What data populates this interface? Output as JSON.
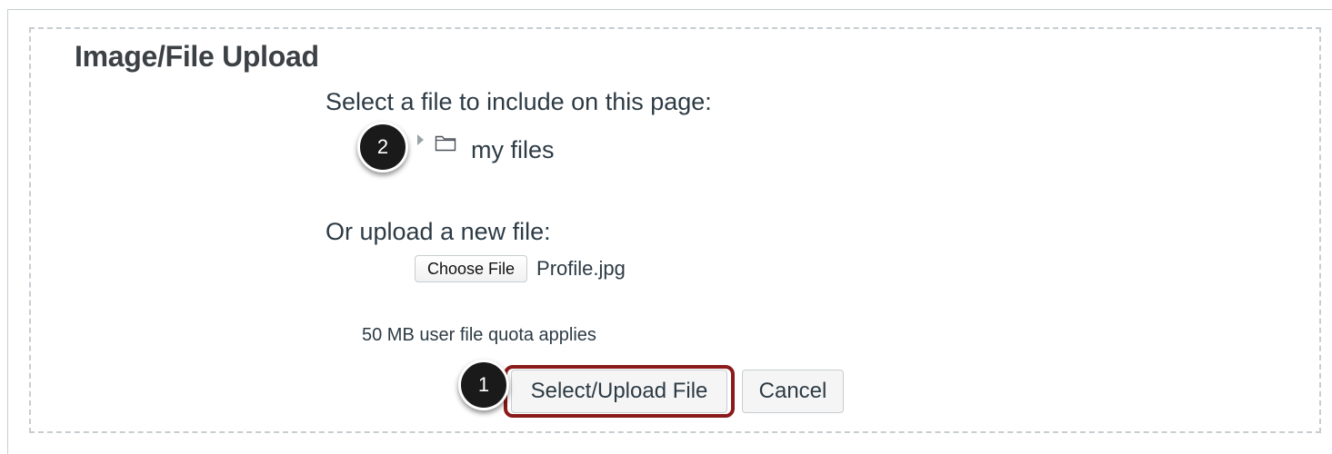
{
  "panel": {
    "title": "Image/File Upload"
  },
  "file_browser": {
    "label": "Select a file to include on this page:",
    "tree": [
      {
        "label": "my files",
        "icon": "folder-icon",
        "expanded": false
      }
    ]
  },
  "upload": {
    "label": "Or upload a new file:",
    "choose_button": "Choose File",
    "selected_file": "Profile.jpg",
    "quota_note": "50 MB user file quota applies"
  },
  "actions": {
    "primary_label": "Select/Upload File",
    "cancel_label": "Cancel"
  },
  "callouts": {
    "one": "1",
    "two": "2"
  },
  "colors": {
    "highlight": "#8b1a1a",
    "text": "#2d3b45",
    "dashed_border": "#c7cdd1",
    "callout_bg": "#1a1a1a"
  }
}
